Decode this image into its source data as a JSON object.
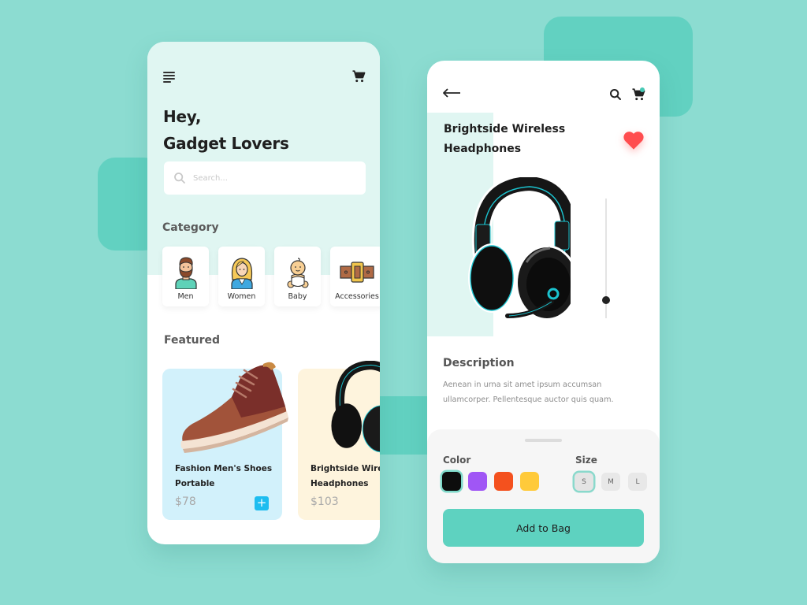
{
  "home": {
    "greeting_line1": "Hey,",
    "greeting_line2": "Gadget Lovers",
    "search": {
      "placeholder": "Search..."
    },
    "category_title": "Category",
    "categories": [
      {
        "label": "Men",
        "icon": "man-avatar-icon"
      },
      {
        "label": "Women",
        "icon": "woman-avatar-icon"
      },
      {
        "label": "Baby",
        "icon": "baby-avatar-icon"
      },
      {
        "label": "Accessories",
        "icon": "belt-icon"
      }
    ],
    "featured_title": "Featured",
    "featured": [
      {
        "name": "Fashion Men's Shoes Portable",
        "price": "$78",
        "add_label": "+"
      },
      {
        "name": "Brightside Wireless Headphones",
        "price": "$103"
      }
    ]
  },
  "product": {
    "title": "Brightside Wireless Headphones",
    "favorite": true,
    "volume_level_fraction": 0.15,
    "description_title": "Description",
    "description": "Aenean in urna sit amet ipsum accumsan ullamcorper. Pellentesque auctor quis quam.",
    "color_label": "Color",
    "colors": [
      "#0d0d0d",
      "#a056f5",
      "#f4511e",
      "#ffca3a"
    ],
    "selected_color_index": 0,
    "size_label": "Size",
    "sizes": [
      "S",
      "M",
      "L"
    ],
    "selected_size": "S",
    "add_to_bag_label": "Add to Bag"
  },
  "theme": {
    "background": "#8cdcd1",
    "accent": "#5ed2c0",
    "heart": "#ff4d4f",
    "plus_button": "#1ebdf0"
  }
}
